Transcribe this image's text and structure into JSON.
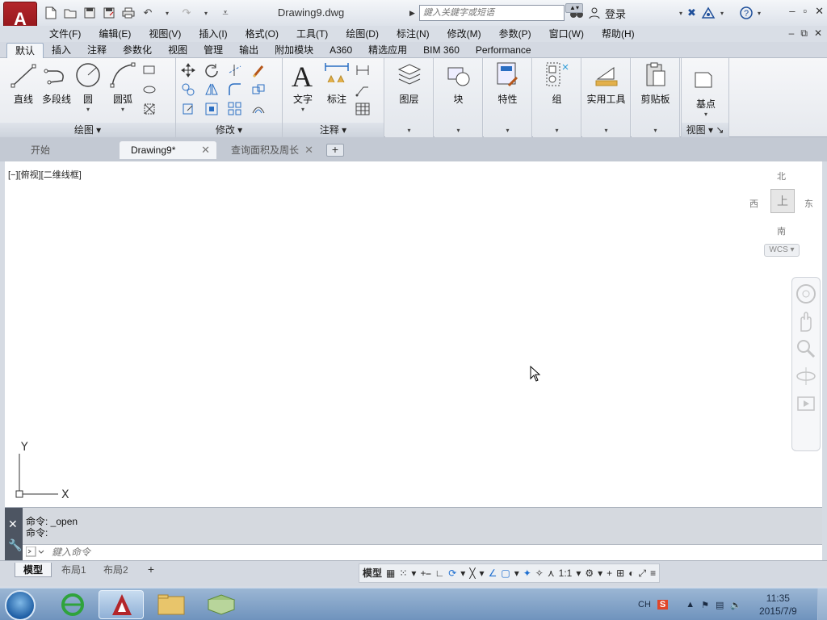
{
  "window": {
    "doc_title": "Drawing9.dwg",
    "app_logo": "A",
    "search_placeholder": "鍵入关鍵字或短语",
    "login_label": "登录"
  },
  "menu": [
    "文件(F)",
    "编辑(E)",
    "视图(V)",
    "插入(I)",
    "格式(O)",
    "工具(T)",
    "绘图(D)",
    "标注(N)",
    "修改(M)",
    "参数(P)",
    "窗口(W)",
    "帮助(H)"
  ],
  "ribbon_tabs": [
    "默认",
    "插入",
    "注释",
    "参数化",
    "视图",
    "管理",
    "输出",
    "附加模块",
    "A360",
    "精选应用",
    "BIM 360",
    "Performance"
  ],
  "ribbon": {
    "draw": {
      "title": "绘图",
      "buttons": [
        "直线",
        "多段线",
        "圆",
        "圆弧"
      ]
    },
    "modify": {
      "title": "修改"
    },
    "annotation": {
      "title": "注释",
      "buttons": [
        "文字",
        "标注"
      ]
    },
    "flyouts": [
      "图层",
      "块",
      "特性",
      "组",
      "实用工具",
      "剪贴板"
    ],
    "view": {
      "button": "基点",
      "title": "视图"
    }
  },
  "doc_tabs": [
    "开始",
    "Drawing9*",
    "查询面积及周长"
  ],
  "viewport_label": "[−][俯视][二维线框]",
  "viewcube": {
    "north": "北",
    "south": "南",
    "east": "东",
    "west": "西",
    "face": "上",
    "wcs": "WCS"
  },
  "ucs": {
    "x": "X",
    "y": "Y"
  },
  "command": {
    "history": [
      "命令: _open",
      "命令:"
    ],
    "placeholder": "鍵入命令"
  },
  "layout_tabs": [
    "模型",
    "布局1",
    "布局2"
  ],
  "status": {
    "model": "模型",
    "scale": "1:1"
  },
  "taskbar": {
    "ime": "CH",
    "time": "11:35",
    "date": "2015/7/9"
  },
  "colors": {
    "brand_red": "#a3191f",
    "accent_blue": "#1f6fd0"
  }
}
